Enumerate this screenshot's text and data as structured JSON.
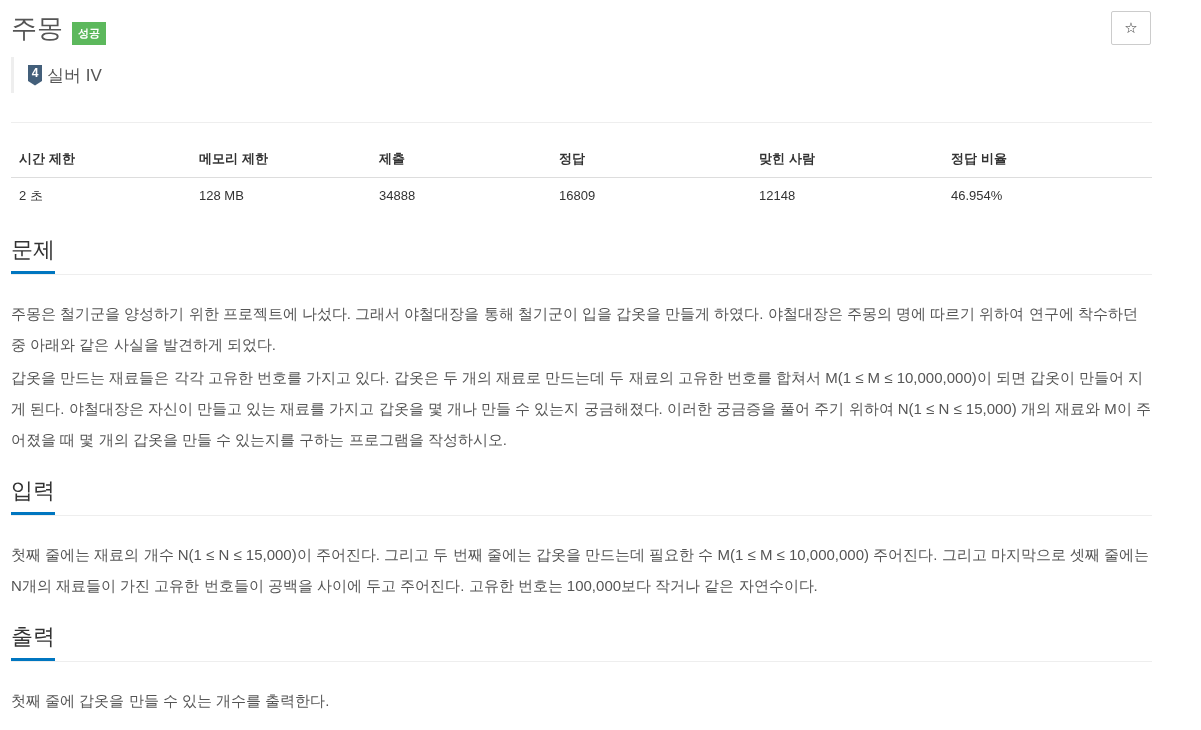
{
  "problem": {
    "title": "주몽",
    "result_badge": "성공",
    "favorite_button": "☆",
    "tier": {
      "number": "4",
      "label": "실버 IV"
    }
  },
  "info_table": {
    "columns": [
      "시간 제한",
      "메모리 제한",
      "제출",
      "정답",
      "맞힌 사람",
      "정답 비율"
    ],
    "rows": [
      [
        "2 초",
        "128 MB",
        "34888",
        "16809",
        "12148",
        "46.954%"
      ]
    ]
  },
  "sections": [
    {
      "heading": "문제",
      "paragraphs": [
        "주몽은 철기군을 양성하기 위한 프로젝트에 나섰다. 그래서 야철대장을 통해 철기군이 입을 갑옷을 만들게 하였다. 야철대장은 주몽의 명에 따르기 위하여 연구에 착수하던 중 아래와 같은 사실을 발견하게 되었다.",
        "갑옷을 만드는 재료들은 각각 고유한 번호를 가지고 있다. 갑옷은 두 개의 재료로 만드는데 두 재료의 고유한 번호를 합쳐서 M(1 ≤ M ≤ 10,000,000)이 되면 갑옷이 만들어 지게 된다. 야철대장은 자신이 만들고 있는 재료를 가지고 갑옷을 몇 개나 만들 수 있는지 궁금해졌다. 이러한 궁금증을 풀어 주기 위하여 N(1 ≤ N ≤ 15,000) 개의 재료와 M이 주어졌을 때 몇 개의 갑옷을 만들 수 있는지를 구하는 프로그램을 작성하시오."
      ]
    },
    {
      "heading": "입력",
      "paragraphs": [
        "첫째 줄에는 재료의 개수 N(1 ≤ N ≤ 15,000)이 주어진다. 그리고 두 번째 줄에는 갑옷을 만드는데 필요한 수 M(1 ≤ M ≤ 10,000,000) 주어진다. 그리고 마지막으로 셋째 줄에는 N개의 재료들이 가진 고유한 번호들이 공백을 사이에 두고 주어진다. 고유한 번호는 100,000보다 작거나 같은 자연수이다."
      ]
    },
    {
      "heading": "출력",
      "paragraphs": [
        "첫째 줄에 갑옷을 만들 수 있는 개수를 출력한다."
      ]
    }
  ]
}
